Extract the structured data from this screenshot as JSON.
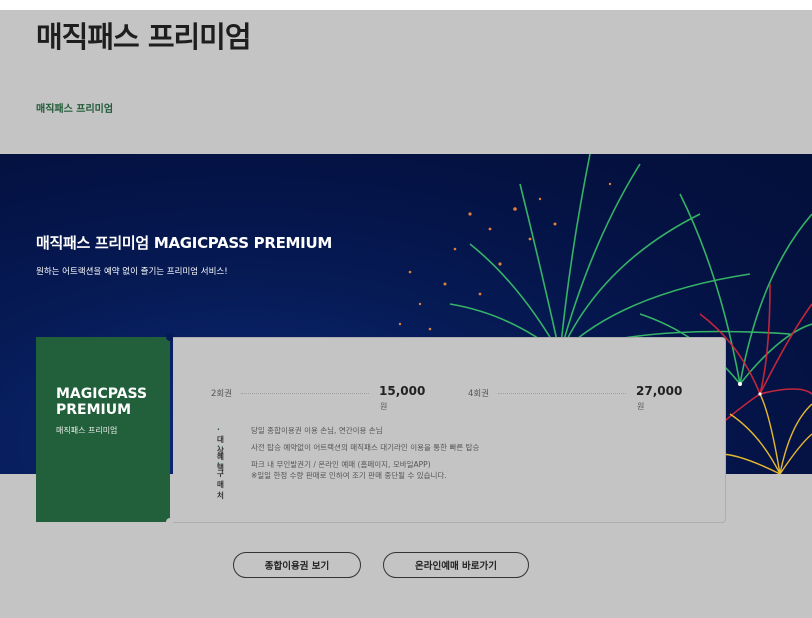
{
  "page": {
    "title": "매직패스 프리미엄",
    "breadcrumb": "매직패스 프리미엄"
  },
  "hero": {
    "title": "매직패스 프리미엄 MAGICPASS PREMIUM",
    "subtitle": "원하는 어트랙션을 예약 없이 즐기는 프리미엄 서비스!"
  },
  "pass": {
    "name": "MAGICPASS\nPREMIUM",
    "subtitle": "매직패스 프리미엄"
  },
  "prices": [
    {
      "label": "2회권",
      "value": "15,000",
      "unit": "원"
    },
    {
      "label": "4회권",
      "value": "27,000",
      "unit": "원"
    }
  ],
  "details": [
    {
      "key": "대상",
      "lines": [
        "당일 종합이용권 이용 손님, 연간이용 손님"
      ]
    },
    {
      "key": "혜택",
      "lines": [
        "사전 탑승 예약없이 어트랙션의 매직패스 대기라인 이용을 통한 빠른 탑승"
      ]
    },
    {
      "key": "구매처",
      "lines": [
        "파크 내 무인발권기 / 온라인 예매 (홈페이지, 모바일APP)",
        "※일일 한정 수량 판매로 인하여 조기 판매 중단될 수 있습니다."
      ]
    }
  ],
  "buttons": {
    "tickets": "종합이용권 보기",
    "online": "온라인예매 바로가기"
  },
  "colors": {
    "accent_green": "#22603c",
    "background": "#c4c4c4",
    "hero_navy": "#061a55"
  }
}
